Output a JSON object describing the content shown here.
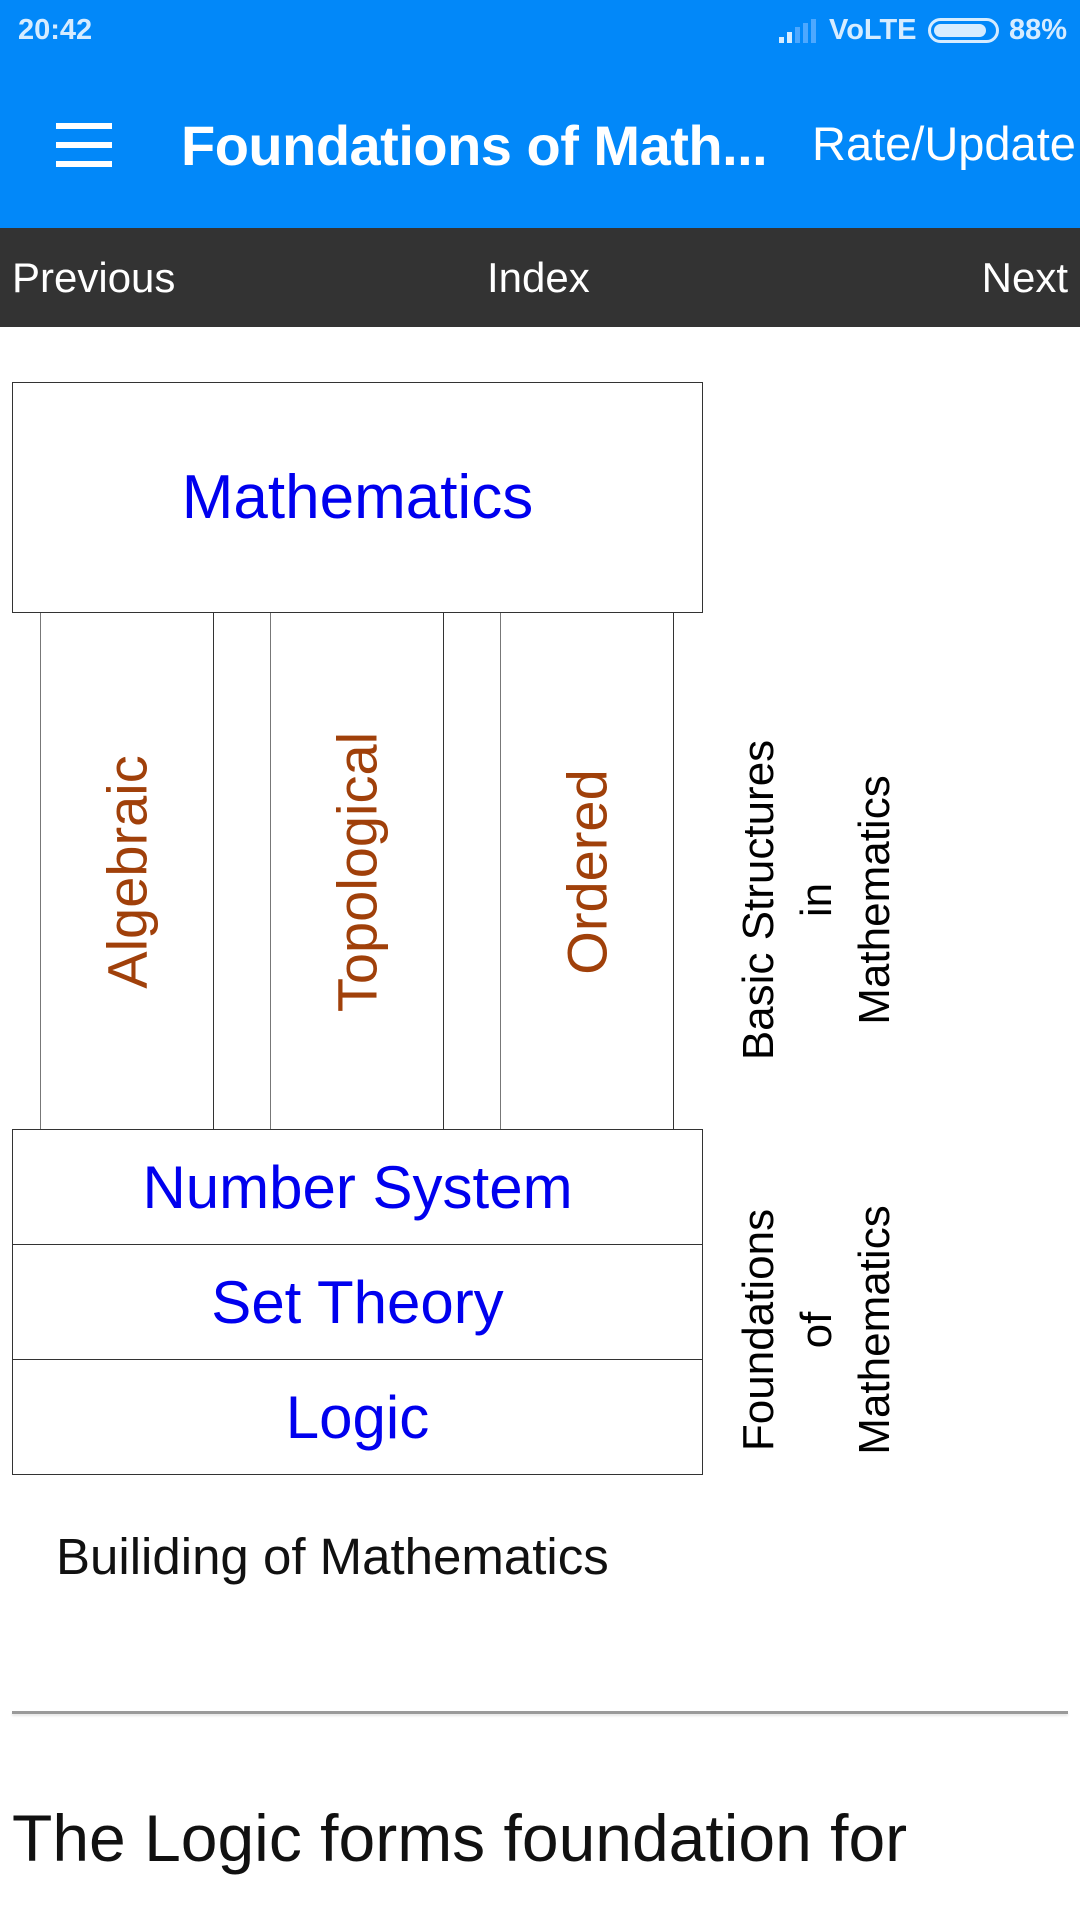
{
  "status_bar": {
    "time": "20:42",
    "signal_bars_active": 2,
    "signal_bars_total": 5,
    "network": "VoLTE",
    "battery_percent": 88,
    "battery_label": "88%",
    "icons": [
      "signal-icon",
      "battery-icon"
    ]
  },
  "app_bar": {
    "menu_icon": "hamburger-menu-icon",
    "title": "Foundations of Math...",
    "action": "Rate/Update",
    "color": "#0288f9"
  },
  "nav_bar": {
    "previous": "Previous",
    "index": "Index",
    "next": "Next",
    "color": "#333333"
  },
  "diagram": {
    "top": "Mathematics",
    "columns": [
      "Algebraic",
      "Topological",
      "Ordered"
    ],
    "layers": [
      "Number System",
      "Set Theory",
      "Logic"
    ],
    "side_labels": {
      "structures": [
        "Basic Structures",
        "in",
        "Mathematics"
      ],
      "foundations": [
        "Foundations",
        "of",
        "Mathematics"
      ]
    },
    "caption": "Builiding of Mathematics",
    "colors": {
      "box_text": "#0000ee",
      "column_text": "#a0400a"
    }
  },
  "content": {
    "paragraph_start": "The Logic forms foundation for"
  }
}
